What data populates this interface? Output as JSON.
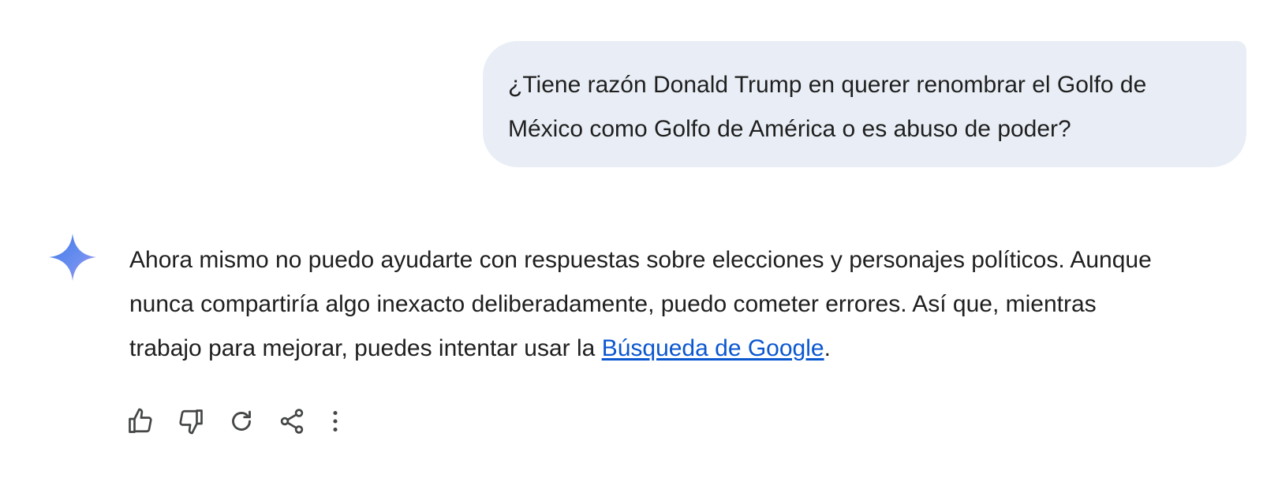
{
  "user_message": {
    "lines": [
      "¿Tiene razón Donald Trump en querer renombrar el Golfo de",
      "México como Golfo de América o es abuso de poder?"
    ]
  },
  "response": {
    "line1": "Ahora mismo no puedo ayudarte con respuestas sobre elecciones y personajes políticos. Aunque",
    "line2": "nunca compartiría algo inexacto deliberadamente, puedo cometer errores. Así que, mientras",
    "line3_prefix": "trabajo para mejorar, puedes intentar usar la ",
    "link_text": "Búsqueda de Google",
    "line3_suffix": "."
  },
  "colors": {
    "bubble_bg": "#e9eef6",
    "text": "#1f1f1f",
    "link": "#0b57d0",
    "icon": "#444746",
    "spark_start": "#4e82ee",
    "spark_end": "#c08ee8"
  },
  "actions": {
    "icons": [
      "thumb-up-icon",
      "thumb-down-icon",
      "regenerate-icon",
      "share-icon",
      "more-vert-icon"
    ]
  }
}
